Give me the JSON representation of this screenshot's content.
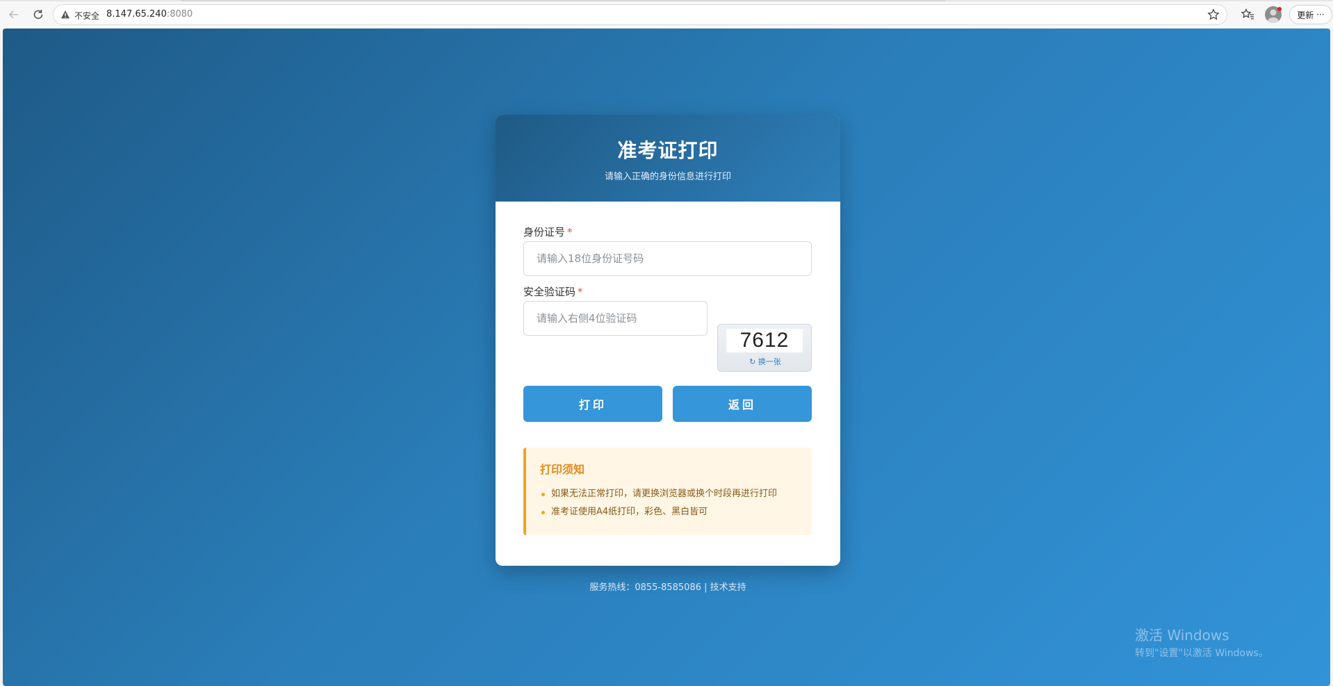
{
  "browser": {
    "insecure_label": "不安全",
    "url_host": "8.147.65.240",
    "url_port": ":8080",
    "update_label": "更新",
    "more_label": "···"
  },
  "header": {
    "title": "准考证打印",
    "subtitle": "请输入正确的身份信息进行打印"
  },
  "form": {
    "id_label": "身份证号",
    "id_placeholder": "请输入18位身份证号码",
    "captcha_label": "安全验证码",
    "captcha_placeholder": "请输入右侧4位验证码",
    "captcha_code": "7612",
    "captcha_refresh": "↻ 换一张",
    "required_mark": "*",
    "print_button": "打印",
    "back_button": "返回"
  },
  "notice": {
    "title": "打印须知",
    "items": [
      "如果无法正常打印，请更换浏览器或换个时段再进行打印",
      "准考证使用A4纸打印，彩色、黑白皆可"
    ]
  },
  "footer": {
    "text": "服务热线：0855-8585086  |  技术支持"
  },
  "watermark": {
    "title": "激活 Windows",
    "subtitle": "转到\"设置\"以激活 Windows。"
  }
}
